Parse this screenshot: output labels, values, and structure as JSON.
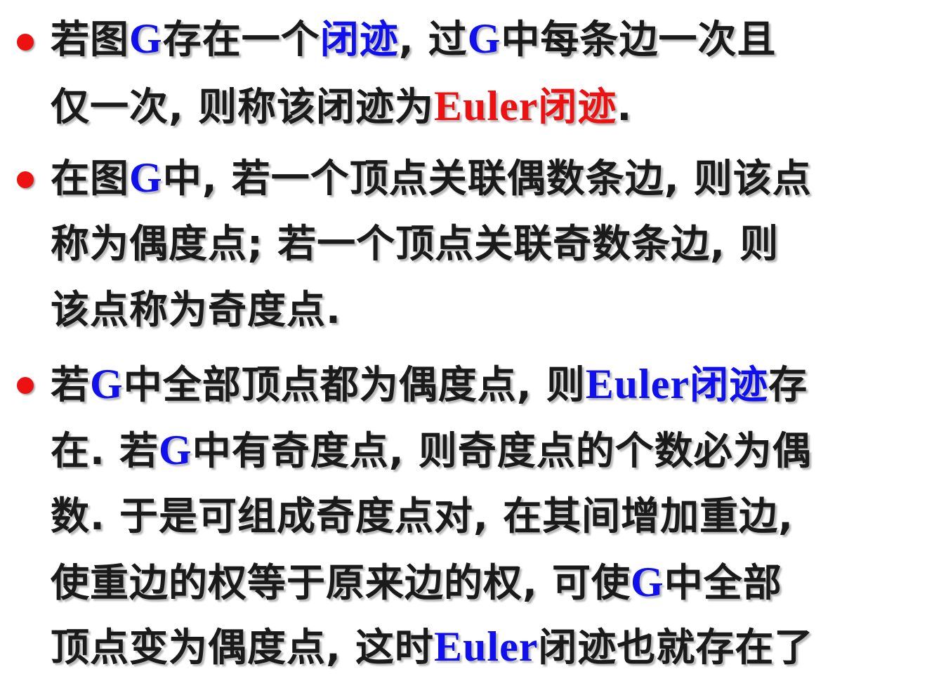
{
  "colors": {
    "text": "#1a1a1a",
    "highlight_blue": "#1010ee",
    "highlight_red": "#ee1111",
    "bullet": "#ee1111"
  },
  "bullets": [
    {
      "lines": [
        [
          "若图",
          "G",
          "存在一个",
          "闭迹",
          ", 过",
          "G",
          "中每条边一次且"
        ],
        [
          "仅一次, 则称该闭迹为",
          "Euler",
          "闭迹",
          "."
        ]
      ]
    },
    {
      "lines": [
        [
          "在图",
          "G",
          "中, 若一个顶点关联偶数条边, 则该点"
        ],
        [
          "称为偶度点; 若一个顶点关联奇数条边, 则"
        ],
        [
          "该点称为奇度点."
        ]
      ]
    },
    {
      "lines": [
        [
          "若",
          "G",
          "中全部顶点都为偶度点, 则",
          "Euler",
          "闭迹",
          "存"
        ],
        [
          "在. 若",
          "G",
          "中有奇度点, 则奇度点的个数必为偶"
        ],
        [
          "数. 于是可组成奇度点对, 在其间增加重边,"
        ],
        [
          "使重边的权等于原来边的权, 可使",
          "G",
          "中全部"
        ],
        [
          "顶点变为偶度点, 这时",
          "Euler",
          "闭迹也就存在了"
        ]
      ]
    }
  ]
}
